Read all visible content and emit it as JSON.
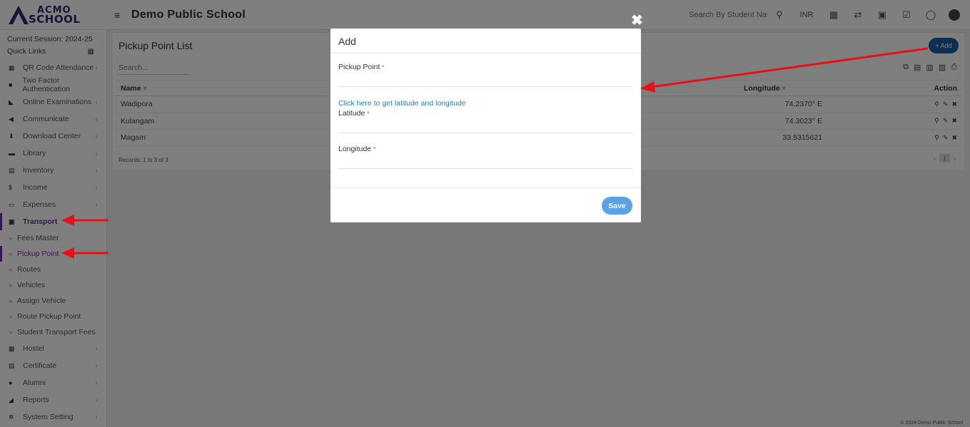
{
  "header": {
    "logo_line1": "ACMO",
    "logo_line2": "SCHOOL",
    "school_name": "Demo Public School",
    "search_placeholder": "Search By Student Name",
    "currency": "INR"
  },
  "sidebar": {
    "session": "Current Session: 2024-25",
    "quick_links": "Quick Links",
    "items": [
      {
        "label": "QR Code Attendance",
        "icon": "qr-icon"
      },
      {
        "label": "Two Factor Authentication",
        "icon": "lock-icon"
      },
      {
        "label": "Online Examinations",
        "icon": "rss-icon"
      },
      {
        "label": "Communicate",
        "icon": "bullhorn-icon"
      },
      {
        "label": "Download Center",
        "icon": "download-icon"
      },
      {
        "label": "Library",
        "icon": "book-icon"
      },
      {
        "label": "Inventory",
        "icon": "inventory-icon"
      },
      {
        "label": "Income",
        "icon": "dollar-icon"
      },
      {
        "label": "Expenses",
        "icon": "card-icon"
      },
      {
        "label": "Transport",
        "icon": "bus-icon"
      }
    ],
    "transport_sub": [
      "Fees Master",
      "Pickup Point",
      "Routes",
      "Vehicles",
      "Assign Vehicle",
      "Route Pickup Point",
      "Student Transport Fees"
    ],
    "items_after": [
      {
        "label": "Hostel",
        "icon": "building-icon"
      },
      {
        "label": "Certificate",
        "icon": "certificate-icon"
      },
      {
        "label": "Alumni",
        "icon": "user-icon"
      },
      {
        "label": "Reports",
        "icon": "chart-icon"
      },
      {
        "label": "System Setting",
        "icon": "gears-icon"
      }
    ]
  },
  "main": {
    "title": "Pickup Point List",
    "add_label": "+ Add",
    "search_placeholder": "Search...",
    "columns": {
      "name": "Name",
      "longitude": "Longitude",
      "action": "Action"
    },
    "rows": [
      {
        "name": "Wadipora",
        "longitude": "74.2370° E"
      },
      {
        "name": "Kulangam",
        "longitude": "74.3023° E"
      },
      {
        "name": "Magam",
        "longitude": "33.5315621"
      }
    ],
    "records": "Records: 1 to 3 of 3",
    "page": "1",
    "footer": "© 2024 Demo Public School"
  },
  "modal": {
    "title": "Add",
    "pickup_label": "Pickup Point",
    "link": "Click here to get latitude and longitude",
    "latitude_label": "Latitude",
    "longitude_label": "Longitude",
    "required": "*",
    "save": "Save",
    "close": "✖"
  },
  "colors": {
    "accent": "#6a2ca8",
    "primary": "#1b5ea8",
    "save": "#5aa1e8",
    "annotation": "#e81010"
  }
}
